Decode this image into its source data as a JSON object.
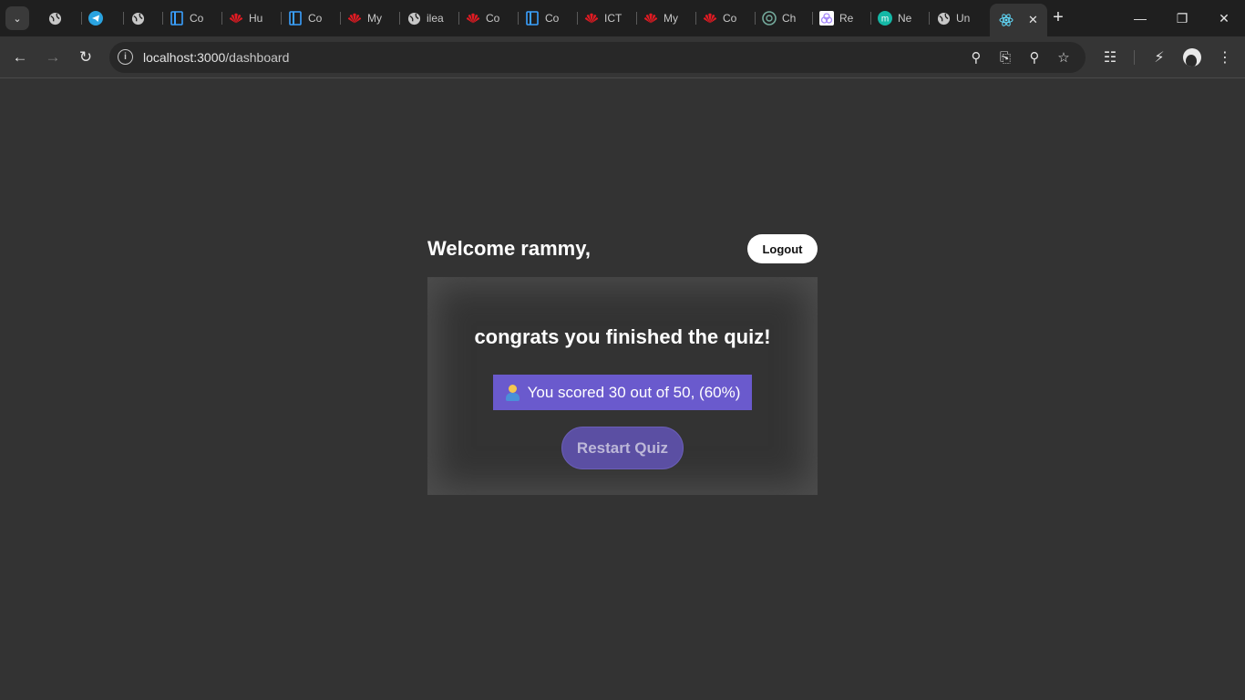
{
  "browser": {
    "tabs": [
      {
        "title": "",
        "icon": "globe-icon",
        "color": "#c7c7c7"
      },
      {
        "title": "",
        "icon": "telegram-icon",
        "color": "#2aa3e0"
      },
      {
        "title": "",
        "icon": "globe-icon",
        "color": "#c7c7c7"
      },
      {
        "title": "Co",
        "icon": "vscode-icon",
        "color": "#3aa0ff"
      },
      {
        "title": "Hu",
        "icon": "huawei-icon",
        "color": "#e31b23"
      },
      {
        "title": "Co",
        "icon": "vscode-icon",
        "color": "#3aa0ff"
      },
      {
        "title": "My",
        "icon": "huawei-icon",
        "color": "#e31b23"
      },
      {
        "title": "ilea",
        "icon": "globe-icon",
        "color": "#c7c7c7"
      },
      {
        "title": "Co",
        "icon": "huawei-icon",
        "color": "#e31b23"
      },
      {
        "title": "Co",
        "icon": "vscode-icon",
        "color": "#3aa0ff"
      },
      {
        "title": "ICT",
        "icon": "huawei-icon",
        "color": "#e31b23"
      },
      {
        "title": "My",
        "icon": "huawei-icon",
        "color": "#e31b23"
      },
      {
        "title": "Co",
        "icon": "huawei-icon",
        "color": "#e31b23"
      },
      {
        "title": "Ch",
        "icon": "chatgpt-icon",
        "color": "#74aa9c"
      },
      {
        "title": "Re",
        "icon": "app-icon",
        "color": "#a78bfa"
      },
      {
        "title": "Ne",
        "icon": "m-badge-icon",
        "color": "#14b8a6"
      },
      {
        "title": "Un",
        "icon": "globe-icon",
        "color": "#c7c7c7"
      }
    ],
    "active_tab_icon": "react-icon",
    "new_tab_label": "+",
    "address": {
      "host": "localhost:3000",
      "path": "/dashboard"
    }
  },
  "page": {
    "welcome": "Welcome rammy,",
    "logout_label": "Logout",
    "congrats": "congrats you finished the quiz!",
    "score_text": "You scored 30 out of 50, (60%)",
    "score": {
      "value": 30,
      "total": 50,
      "percent": 60
    },
    "restart_label": "Restart Quiz"
  },
  "colors": {
    "page_bg": "#333333",
    "accent": "#6a5acd",
    "restart_bg": "#5b4fa3",
    "text": "#ffffff"
  }
}
